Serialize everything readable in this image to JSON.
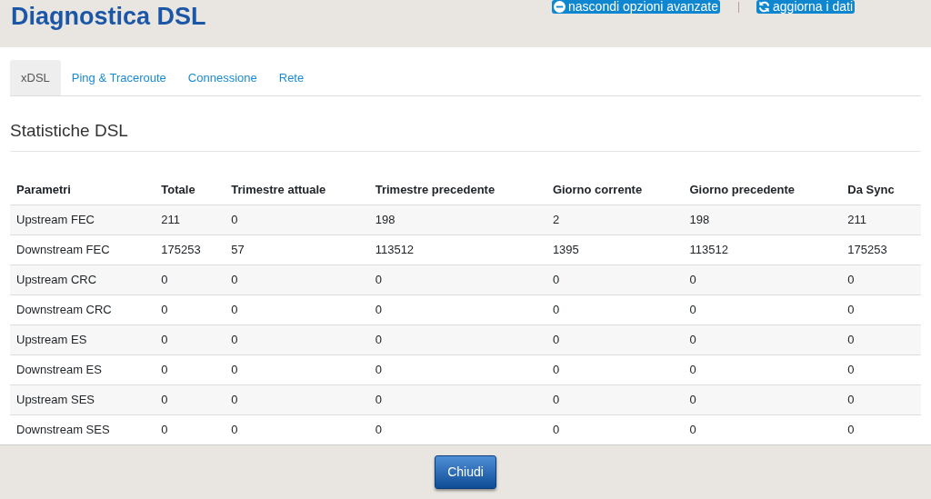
{
  "title": "Diagnostica DSL",
  "header_actions": [
    {
      "kind": "hide",
      "label": "nascondi opzioni avanzate"
    },
    {
      "kind": "refresh",
      "label": "aggiorna i dati"
    }
  ],
  "tabs": [
    {
      "label": "xDSL",
      "selected": true
    },
    {
      "label": "Ping & Traceroute",
      "selected": false
    },
    {
      "label": "Connessione",
      "selected": false
    },
    {
      "label": "Rete",
      "selected": false
    }
  ],
  "section_title": "Statistiche DSL",
  "table": {
    "columns": [
      "Parametri",
      "Totale",
      "Trimestre attuale",
      "Trimestre precedente",
      "Giorno corrente",
      "Giorno precedente",
      "Da Sync"
    ],
    "rows": [
      [
        "Upstream FEC",
        "211",
        "0",
        "198",
        "2",
        "198",
        "211"
      ],
      [
        "Downstream FEC",
        "175253",
        "57",
        "113512",
        "1395",
        "113512",
        "175253"
      ],
      [
        "Upstream CRC",
        "0",
        "0",
        "0",
        "0",
        "0",
        "0"
      ],
      [
        "Downstream CRC",
        "0",
        "0",
        "0",
        "0",
        "0",
        "0"
      ],
      [
        "Upstream ES",
        "0",
        "0",
        "0",
        "0",
        "0",
        "0"
      ],
      [
        "Downstream ES",
        "0",
        "0",
        "0",
        "0",
        "0",
        "0"
      ],
      [
        "Upstream SES",
        "0",
        "0",
        "0",
        "0",
        "0",
        "0"
      ],
      [
        "Downstream SES",
        "0",
        "0",
        "0",
        "0",
        "0",
        "0"
      ]
    ]
  },
  "footer_button": "Chiudi"
}
